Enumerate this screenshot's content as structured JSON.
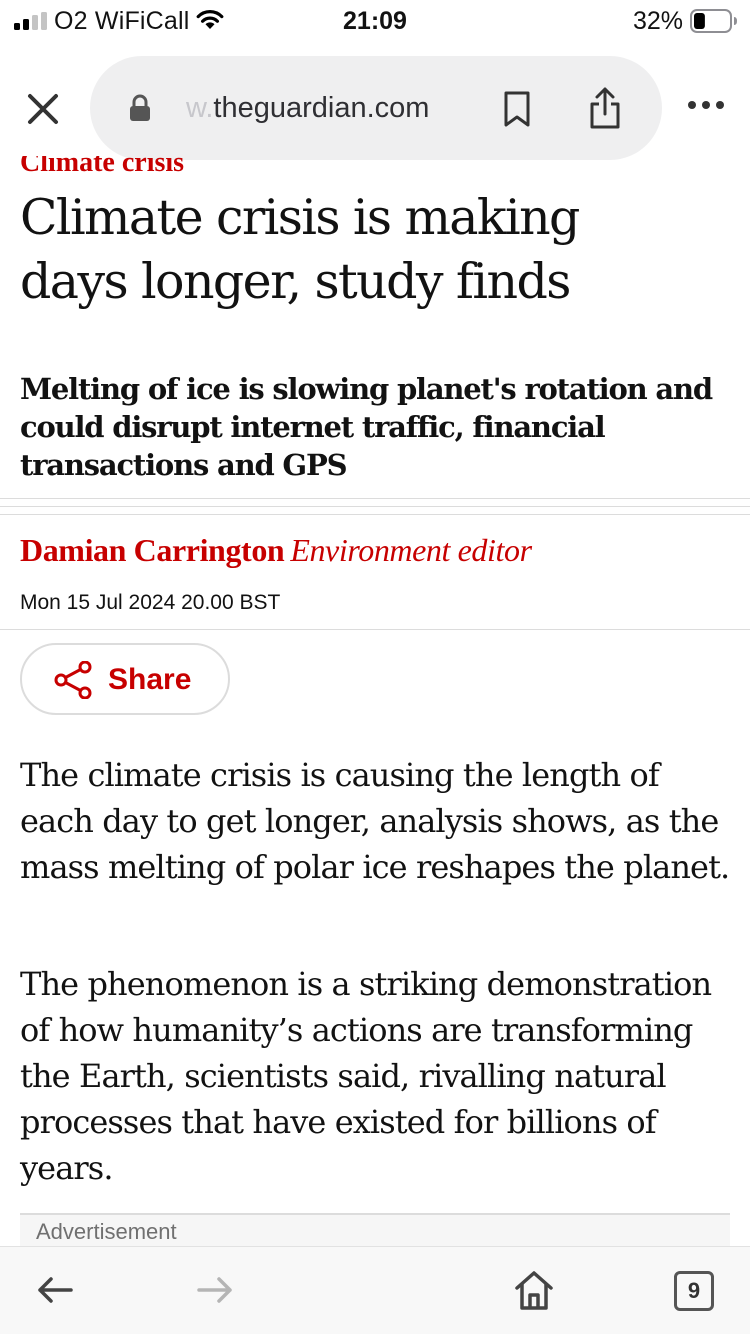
{
  "status_bar": {
    "carrier": "O2 WiFiCall",
    "time": "21:09",
    "battery_percent": "32%",
    "battery_level": 0.32,
    "icons": [
      "signal-icon",
      "wifi-icon",
      "battery-icon"
    ]
  },
  "browser": {
    "url_fade": "w.",
    "url_domain": "theguardian.com",
    "icons": [
      "close-icon",
      "lock-icon",
      "bookmark-icon",
      "share-page-icon",
      "more-icon"
    ]
  },
  "article": {
    "kicker": "Climate crisis",
    "headline_line1": "Climate crisis is making",
    "headline_line2": "days longer, study finds",
    "standfirst": "Melting of ice is slowing planet's rotation and could disrupt internet traffic, financial transactions and GPS",
    "byline_name": "Damian Carrington",
    "byline_role": "Environment editor",
    "dateline": "Mon 15 Jul 2024 20.00 BST",
    "share_label": "Share",
    "paragraphs": [
      "The climate crisis is causing the length of each day to get longer, analysis shows, as the mass melting of polar ice reshapes the planet.",
      "The phenomenon is a striking demonstration of how humanity’s actions are transforming the Earth, scientists said, rivalling natural processes that have existed for billions of years."
    ],
    "advertisement_label": "Advertisement"
  },
  "toolbar": {
    "tabs_count": "9",
    "icons": [
      "back-icon",
      "forward-icon",
      "home-icon",
      "tabs-icon"
    ]
  },
  "colors": {
    "guardian_red": "#c70000",
    "text": "#121212",
    "url_pill": "#efeff0",
    "rule": "#dcdcdc"
  }
}
